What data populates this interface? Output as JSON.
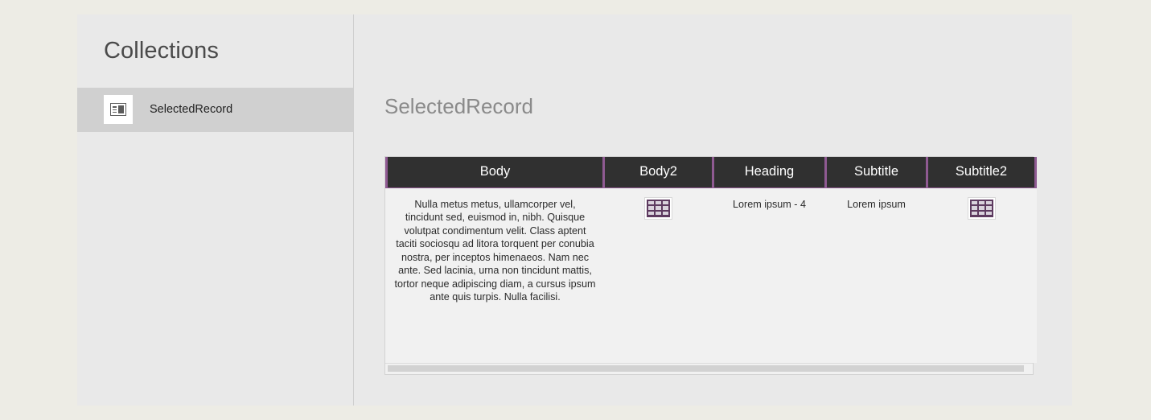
{
  "window": {
    "background_color": "#e9e9e9",
    "page_background_color": "#edece5"
  },
  "sidebar": {
    "title": "Collections",
    "items": [
      {
        "label": "SelectedRecord",
        "icon": "record-card-icon",
        "selected": true
      }
    ]
  },
  "main": {
    "title": "SelectedRecord",
    "accent_color": "#8f5a92",
    "header_background": "#303030"
  },
  "table_data": {
    "type": "table",
    "columns": [
      "Body",
      "Body2",
      "Heading",
      "Subtitle",
      "Subtitle2"
    ],
    "rows": [
      {
        "Body": "Nulla metus metus, ullamcorper vel, tincidunt sed, euismod in, nibh. Quisque volutpat condimentum velit. Class aptent taciti sociosqu ad litora torquent per conubia nostra, per inceptos himenaeos. Nam nec ante. Sed lacinia, urna non tincidunt mattis, tortor neque adipiscing diam, a cursus ipsum ante quis turpis. Nulla facilisi.",
        "Body2": "table-glyph-icon",
        "Heading": "Lorem ipsum - 4",
        "Subtitle": "Lorem ipsum",
        "Subtitle2": "table-glyph-icon"
      }
    ]
  },
  "scrollbar": {
    "orientation": "horizontal",
    "position": "bottom"
  }
}
